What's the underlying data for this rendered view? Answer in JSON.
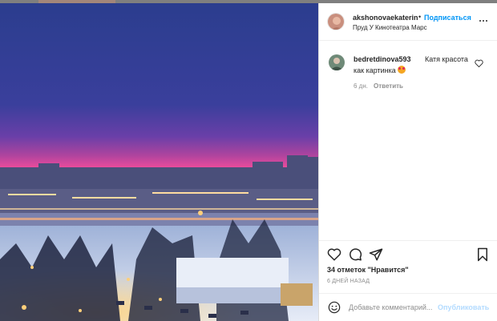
{
  "post": {
    "username": "akshonovaekaterin",
    "separator": "•",
    "follow_label": "Подписаться",
    "location": "Пруд У Кинотеатра Марс"
  },
  "comments": [
    {
      "username": "bedretdinova593",
      "text_line1": "Катя красота",
      "text_line2": "как картинка",
      "age": "6 дн.",
      "reply_label": "Ответить"
    }
  ],
  "footer": {
    "likes": "34 отметок \"Нравится\"",
    "date": "6 ДНЕЙ НАЗАД",
    "comment_placeholder": "Добавьте комментарий...",
    "publish_label": "Опубликовать"
  },
  "icons": {
    "more": "more-options-icon",
    "comment_like": "heart-icon",
    "like": "heart-icon",
    "comment": "comment-bubble-icon",
    "share": "paper-plane-icon",
    "save": "bookmark-icon",
    "emoji": "smiley-icon",
    "comment_emoji": "heart-eyes-emoji"
  },
  "colors": {
    "accent": "#0095f6",
    "publish_disabled": "#b3dbff",
    "secondary_text": "#8e8e8e"
  }
}
